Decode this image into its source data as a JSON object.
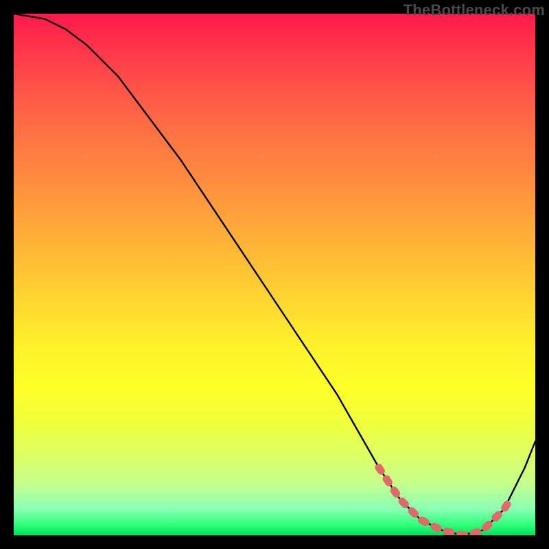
{
  "watermark": "TheBottleneck.com",
  "chart_data": {
    "type": "line",
    "title": "",
    "xlabel": "",
    "ylabel": "",
    "xlim": [
      0,
      100
    ],
    "ylim": [
      0,
      100
    ],
    "series": [
      {
        "name": "bottleneck-curve",
        "x": [
          0,
          6,
          10,
          14,
          20,
          26,
          32,
          38,
          44,
          50,
          56,
          62,
          66,
          70,
          74,
          78,
          82,
          86,
          90,
          94,
          98,
          100
        ],
        "values": [
          100,
          99,
          97,
          94,
          88,
          80,
          72,
          63,
          54,
          45,
          36,
          27,
          20,
          13,
          7,
          3,
          1,
          0,
          1,
          5,
          13,
          18
        ]
      }
    ],
    "highlight": {
      "name": "optimal-band",
      "x": [
        70,
        72,
        74,
        76,
        78,
        80,
        82,
        84,
        86,
        88,
        90,
        92,
        94,
        95
      ],
      "values": [
        13,
        10,
        7,
        5,
        3,
        2,
        1,
        0.5,
        0,
        0.3,
        1,
        3,
        5,
        6.5
      ]
    }
  }
}
